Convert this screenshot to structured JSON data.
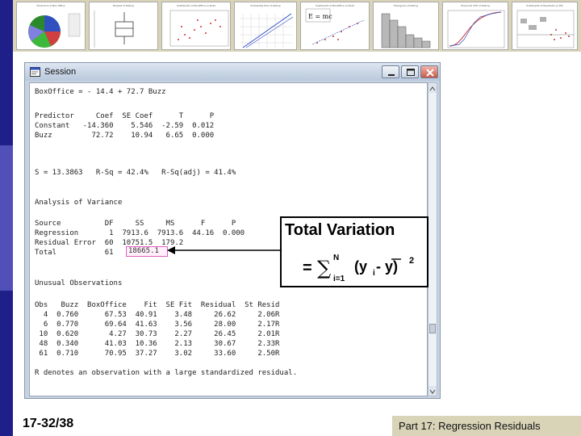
{
  "window": {
    "title": "Session"
  },
  "session": {
    "lines": [
      "BoxOffice = - 14.4 + 72.7 Buzz",
      "",
      "Predictor     Coef  SE Coef      T      P",
      "Constant   -14.360    5.546  -2.59  0.012",
      "Buzz         72.72    10.94   6.65  0.000",
      "",
      "",
      "S = 13.3863   R-Sq = 42.4%   R-Sq(adj) = 41.4%",
      "",
      "",
      "Analysis of Variance",
      "",
      "Source          DF     SS     MS      F      P",
      "Regression       1  7913.6  7913.6  44.16  0.000",
      "Residual Error  60  10751.5  179.2",
      "Total           61",
      "",
      "Unusual Observations",
      "",
      "Obs   Buzz  BoxOffice    Fit  SE Fit  Residual  St Resid",
      "  4  0.760      67.53  40.91    3.48     26.62     2.06R",
      "  6  0.770      69.64  41.63    3.56     28.00     2.17R",
      " 10  0.620       4.27  30.73    2.27     26.45     2.01R",
      " 48  0.340      41.03  10.36    2.13     30.67     2.33R",
      " 61  0.710      70.95  37.27    3.02     33.60     2.50R",
      "",
      "R denotes an observation with a large standardized residual."
    ],
    "highlighted_total_ss": "18665.1"
  },
  "callout": {
    "title": "Total Variation",
    "formula_equals": "=",
    "formula_upper": "N",
    "formula_lower": "i=1",
    "formula_body": "(y",
    "formula_sub": "i",
    "formula_mid": " - y)",
    "formula_power": "2"
  },
  "thumbnails": [
    {
      "title": "Predictors of Box Office"
    },
    {
      "title": "Boxplot of Rating"
    },
    {
      "title": "Scatterplot of BoxOffice vs Buzz"
    },
    {
      "title": "Probability Plot of Rating"
    },
    {
      "title": "Scatterplot of BoxOffice vs Buzz"
    },
    {
      "title": "Histogram of Rating"
    },
    {
      "title": "Empirical CDF of Rating"
    },
    {
      "title": "Scatterplot of Residuals vs Fits"
    }
  ],
  "slide": {
    "number": "17-32/38",
    "footer": "Part 17: Regression Residuals"
  },
  "colors": {
    "left_bar": "#1f1f8a",
    "strip": "#d9d3b8",
    "highlight_border": "#e060c0"
  }
}
